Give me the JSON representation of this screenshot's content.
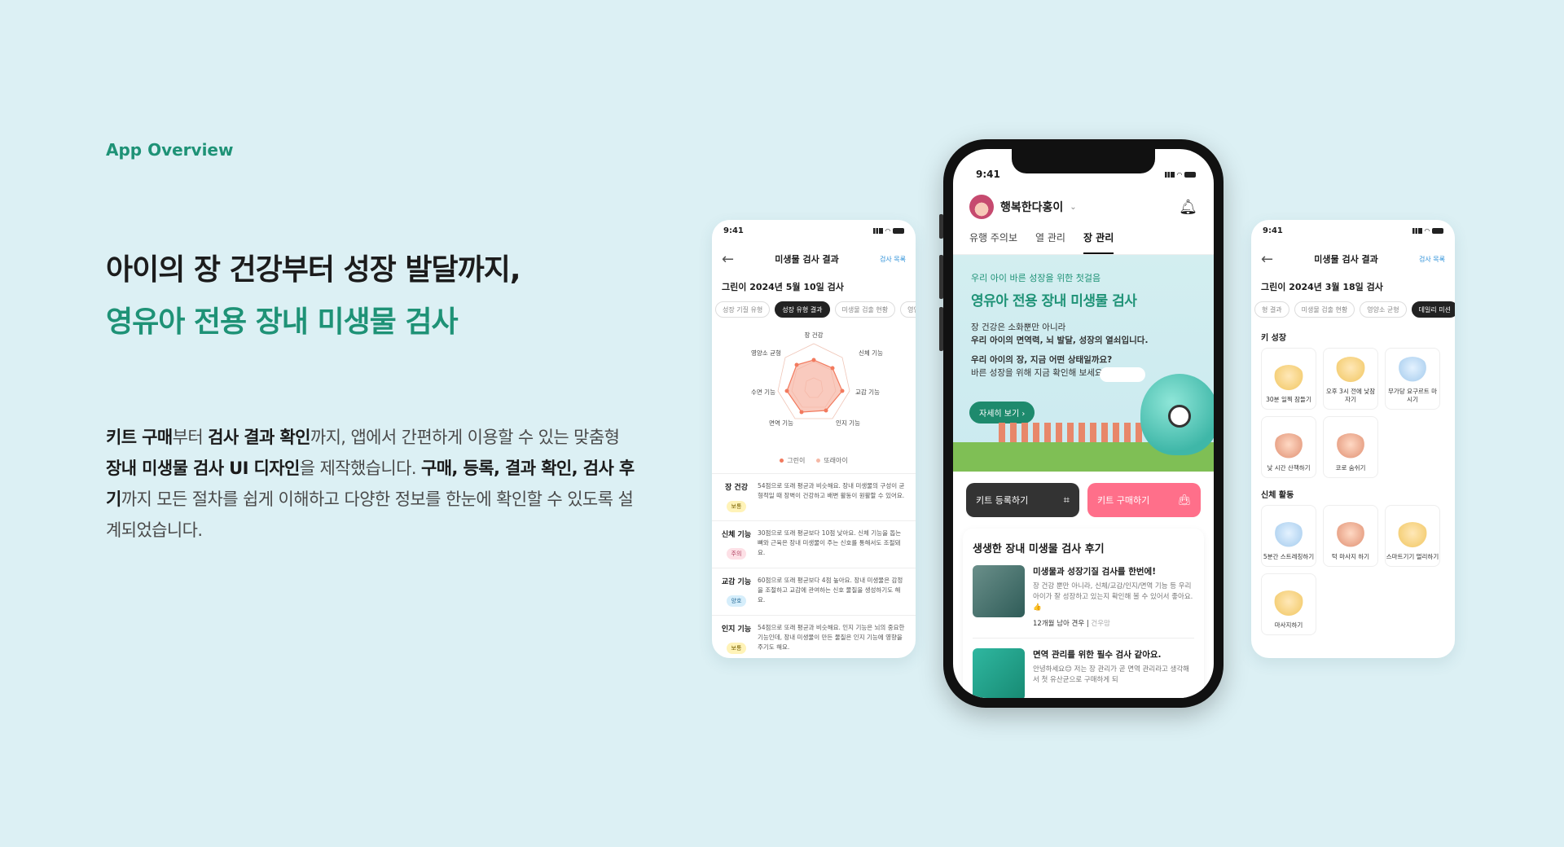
{
  "overview_label": "App Overview",
  "headline": {
    "line1": "아이의 장 건강부터 성장 발달까지,",
    "line2": "영유아 전용 장내 미생물 검사"
  },
  "description": {
    "p1_b1": "키트 구매",
    "p1_t1": "부터 ",
    "p1_b2": "검사 결과 확인",
    "p1_t2": "까지, 앱에서 간편하게 이용할 수 있는 맞춤형 ",
    "p1_b3": "장내 미생물 검사 UI 디자인",
    "p1_t3": "을 제작했습니다. ",
    "p1_b4": "구매, 등록, 결과 확인, 검사 후기",
    "p1_t4": "까지 모든 절차를 쉽게 이해하고 다양한 정보를 한눈에 확인할 수 있도록 설계되었습니다."
  },
  "left_screen": {
    "time": "9:41",
    "nav_title": "미생물 검사 결과",
    "nav_link": "검사 목록",
    "result_title": "그린이 2024년 5월 10일 검사",
    "chips": [
      "성장 기질 유형",
      "성장 유형 결과",
      "미생물 검출 현황",
      "영양"
    ],
    "radar_labels": [
      "장 건강",
      "신체 기능",
      "교감 기능",
      "인지 기능",
      "면역 기능",
      "수면 기능",
      "영양소 균형"
    ],
    "legend": [
      "그린이",
      "또래아이"
    ],
    "results": [
      {
        "name": "장 건강",
        "badge": "보통",
        "text": "54점으로 또래 평균과 비슷해요. 장내 미생물의 구성이 균형적일 때 장벽이 건강하고 배변 활동이 원활할 수 있어요."
      },
      {
        "name": "신체 기능",
        "badge": "주의",
        "text": "30점으로 또래 평균보다 10점 낮아요. 신체 기능을 돕는 뼈와 근육은 장내 미생물이 주는 신호를 통해서도 조절돼요."
      },
      {
        "name": "교감 기능",
        "badge": "양호",
        "text": "60점으로 또래 평균보다 4점 높아요. 장내 미생물은 감정을 조절하고 교감에 관여하는 신호 물질을 생성하기도 해요."
      },
      {
        "name": "인지 기능",
        "badge": "보통",
        "text": "54점으로 또래 평균과 비슷해요. 인지 기능은 뇌의 중요한 기능인데, 장내 미생물이 만든 물질은 인지 기능에 영향을 주기도 해요."
      }
    ]
  },
  "center_screen": {
    "time": "9:41",
    "user_name": "행복한다홍이",
    "tabs": [
      "유행 주의보",
      "열 관리",
      "장 관리"
    ],
    "hero_kicker": "우리 아이 바른 성장을 위한 첫걸음",
    "hero_title": "영유아 전용 장내 미생물 검사",
    "hero_body_1a": "장 건강은 소화뿐만 아니라",
    "hero_body_1b": "우리 아이의 면역력, 뇌 발달, 성장의 열쇠입니다.",
    "hero_body_2a": "우리 아이의 장, 지금 어떤 상태일까요?",
    "hero_body_2b": "바른 성장을 위해 지금 확인해 보세요!",
    "hero_button": "자세히 보기",
    "register_button": "키트 등록하기",
    "buy_button": "키트 구매하기",
    "reviews_title": "생생한 장내 미생물 검사 후기",
    "reviews": [
      {
        "title": "미생물과 성장기질 검사를 한번에!",
        "body": "장 건강 뿐만 아니라, 신체/교감/인지/면역 기능 등 우리 아이가 잘 성장하고 있는지 확인해 볼 수 있어서 좋아요.👍",
        "meta": "12개월 남아 견우",
        "meta2": "건우맘"
      },
      {
        "title": "면역 관리를 위한 필수 검사 같아요.",
        "body": "안녕하세요😊 저는 장 관리가 곧 면역 관리라고 생각해서 첫 유산균으로 구매하게 되",
        "meta": "",
        "meta2": ""
      }
    ]
  },
  "right_screen": {
    "time": "9:41",
    "nav_title": "미생물 검사 결과",
    "nav_link": "검사 목록",
    "result_title": "그린이 2024년 3월 18일 검사",
    "chips": [
      "형 결과",
      "미생물 검출 현황",
      "영양소 균형",
      "데일리 미션"
    ],
    "section1": "키 성장",
    "section1_items": [
      "30분 일찍 잠들기",
      "오후 3시 전에 낮잠자기",
      "무가당 요구르트 마시기",
      "낮 시간 산책하기",
      "코로 숨쉬기"
    ],
    "section2": "신체 활동",
    "section2_items": [
      "5분간 스트레칭하기",
      "턱 마사지 하기",
      "스마트기기 멀리하기",
      "마사지하기"
    ]
  },
  "colors": {
    "background": "#dcf0f4",
    "accent": "#1e9276",
    "pink": "#ff6f8a"
  }
}
